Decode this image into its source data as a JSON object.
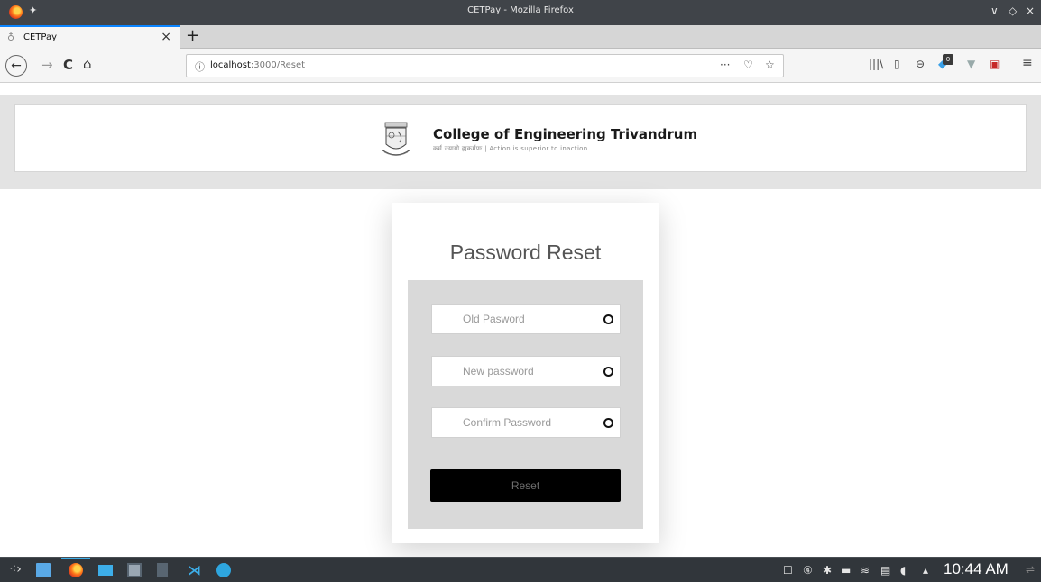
{
  "window": {
    "title": "CETPay - Mozilla Firefox",
    "minimize_glyph": "∨",
    "restore_glyph": "◇",
    "close_glyph": "×"
  },
  "tabs": [
    {
      "label": "CETPay",
      "icon": "page-icon",
      "close_glyph": "×"
    }
  ],
  "new_tab_glyph": "+",
  "nav": {
    "back_glyph": "←",
    "forward_glyph": "→",
    "reload_glyph": "C",
    "home_glyph": "⌂",
    "url_host": "localhost",
    "url_path": ":3000/Reset",
    "page_actions_glyph": "···",
    "pocket_glyph": "♡",
    "bookmark_glyph": "☆",
    "extension_badge": "0"
  },
  "header": {
    "college_name": "College of Engineering Trivandrum",
    "motto": "कर्म ज्यायो ह्यकर्मणः | Action is superior to inaction"
  },
  "form": {
    "title": "Password Reset",
    "old_password_placeholder": "Old Pasword",
    "new_password_placeholder": "New password",
    "confirm_password_placeholder": "Confirm Password",
    "submit_label": "Reset"
  },
  "taskbar": {
    "clock": "10:44 AM"
  },
  "colors": {
    "accent": "#0a84ff",
    "button_bg": "#000000",
    "panel_bg": "#d9d9d9",
    "taskbar_bg": "#31363b"
  }
}
